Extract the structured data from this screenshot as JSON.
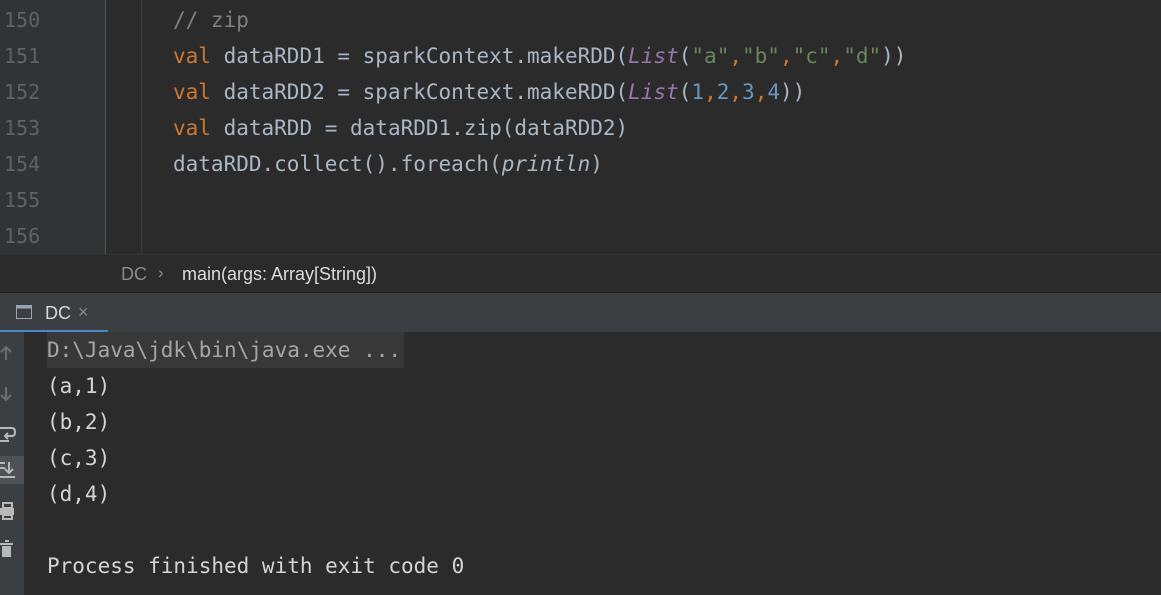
{
  "editor": {
    "line_numbers": [
      "150",
      "151",
      "152",
      "153",
      "154",
      "155",
      "156"
    ],
    "lines": [
      [
        {
          "t": "// zip",
          "c": "cm"
        }
      ],
      [
        {
          "t": "val",
          "c": "kw"
        },
        {
          "t": " dataRDD1 = sparkContext.makeRDD(",
          "c": ""
        },
        {
          "t": "List",
          "c": "it"
        },
        {
          "t": "(",
          "c": ""
        },
        {
          "t": "\"a\"",
          "c": "str"
        },
        {
          "t": ",",
          "c": "kw"
        },
        {
          "t": "\"b\"",
          "c": "str"
        },
        {
          "t": ",",
          "c": "kw"
        },
        {
          "t": "\"c\"",
          "c": "str"
        },
        {
          "t": ",",
          "c": "kw"
        },
        {
          "t": "\"d\"",
          "c": "str"
        },
        {
          "t": "))",
          "c": ""
        }
      ],
      [
        {
          "t": "val",
          "c": "kw"
        },
        {
          "t": " dataRDD2 = sparkContext.makeRDD(",
          "c": ""
        },
        {
          "t": "List",
          "c": "it"
        },
        {
          "t": "(",
          "c": ""
        },
        {
          "t": "1",
          "c": "num"
        },
        {
          "t": ",",
          "c": "kw"
        },
        {
          "t": "2",
          "c": "num"
        },
        {
          "t": ",",
          "c": "kw"
        },
        {
          "t": "3",
          "c": "num"
        },
        {
          "t": ",",
          "c": "kw"
        },
        {
          "t": "4",
          "c": "num"
        },
        {
          "t": "))",
          "c": ""
        }
      ],
      [
        {
          "t": "val",
          "c": "kw"
        },
        {
          "t": " dataRDD = dataRDD1.zip(dataRDD2)",
          "c": ""
        }
      ],
      [
        {
          "t": "dataRDD.collect().foreach(",
          "c": ""
        },
        {
          "t": "println",
          "c": "fn-it"
        },
        {
          "t": ")",
          "c": ""
        }
      ],
      [],
      []
    ]
  },
  "breadcrumb": {
    "object": "DC",
    "separator": "›",
    "method": "main(args: Array[String])"
  },
  "run_tab": {
    "label": "DC",
    "close": "×"
  },
  "tool_icons": [
    "up-arrow-icon",
    "down-arrow-icon",
    "soft-wrap-icon",
    "scroll-to-end-icon",
    "print-icon",
    "trash-icon"
  ],
  "console": {
    "command": "D:\\Java\\jdk\\bin\\java.exe ...",
    "output": [
      "(a,1)",
      "(b,2)",
      "(c,3)",
      "(d,4)"
    ],
    "exit_message": "Process finished with exit code 0"
  },
  "colors": {
    "keyword": "#cc7832",
    "string": "#6a8759",
    "number": "#6897bb",
    "comment": "#808080",
    "italic_type": "#9876aa",
    "default": "#a9b7c6"
  }
}
